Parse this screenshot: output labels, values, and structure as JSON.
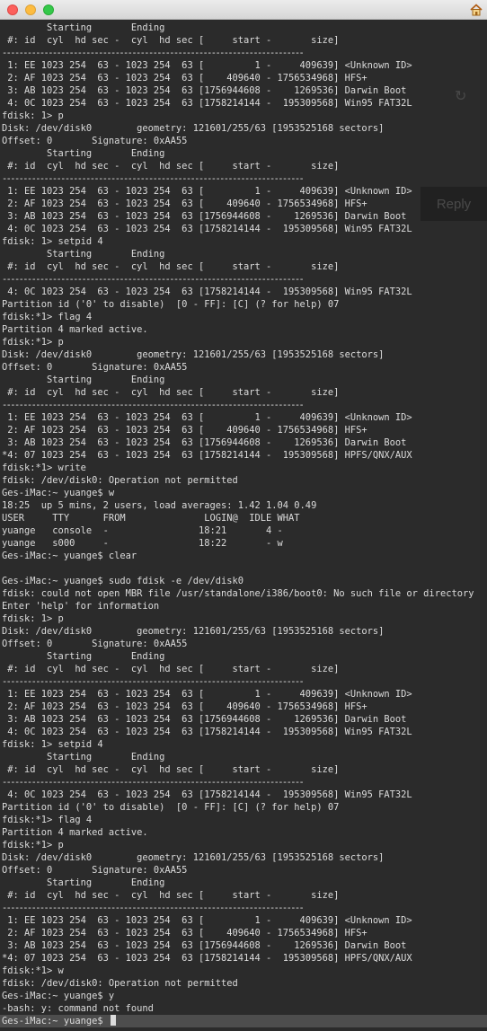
{
  "window": {
    "title": ""
  },
  "terminal": {
    "lines": [
      "        Starting       Ending",
      " #: id  cyl  hd sec -  cyl  hd sec [     start -       size]",
      "------------------------------------------------------------------------",
      " 1: EE 1023 254  63 - 1023 254  63 [         1 -     409639] <Unknown ID>",
      " 2: AF 1023 254  63 - 1023 254  63 [    409640 - 1756534968] HFS+",
      " 3: AB 1023 254  63 - 1023 254  63 [1756944608 -    1269536] Darwin Boot",
      " 4: 0C 1023 254  63 - 1023 254  63 [1758214144 -  195309568] Win95 FAT32L",
      "fdisk: 1> p",
      "Disk: /dev/disk0        geometry: 121601/255/63 [1953525168 sectors]",
      "Offset: 0       Signature: 0xAA55",
      "        Starting       Ending",
      " #: id  cyl  hd sec -  cyl  hd sec [     start -       size]",
      "------------------------------------------------------------------------",
      " 1: EE 1023 254  63 - 1023 254  63 [         1 -     409639] <Unknown ID>",
      " 2: AF 1023 254  63 - 1023 254  63 [    409640 - 1756534968] HFS+",
      " 3: AB 1023 254  63 - 1023 254  63 [1756944608 -    1269536] Darwin Boot",
      " 4: 0C 1023 254  63 - 1023 254  63 [1758214144 -  195309568] Win95 FAT32L",
      "fdisk: 1> setpid 4",
      "        Starting       Ending",
      " #: id  cyl  hd sec -  cyl  hd sec [     start -       size]",
      "------------------------------------------------------------------------",
      " 4: 0C 1023 254  63 - 1023 254  63 [1758214144 -  195309568] Win95 FAT32L",
      "Partition id ('0' to disable)  [0 - FF]: [C] (? for help) 07",
      "fdisk:*1> flag 4",
      "Partition 4 marked active.",
      "fdisk:*1> p",
      "Disk: /dev/disk0        geometry: 121601/255/63 [1953525168 sectors]",
      "Offset: 0       Signature: 0xAA55",
      "        Starting       Ending",
      " #: id  cyl  hd sec -  cyl  hd sec [     start -       size]",
      "------------------------------------------------------------------------",
      " 1: EE 1023 254  63 - 1023 254  63 [         1 -     409639] <Unknown ID>",
      " 2: AF 1023 254  63 - 1023 254  63 [    409640 - 1756534968] HFS+",
      " 3: AB 1023 254  63 - 1023 254  63 [1756944608 -    1269536] Darwin Boot",
      "*4: 07 1023 254  63 - 1023 254  63 [1758214144 -  195309568] HPFS/QNX/AUX",
      "fdisk:*1> write",
      "fdisk: /dev/disk0: Operation not permitted",
      "Ges-iMac:~ yuange$ w",
      "18:25  up 5 mins, 2 users, load averages: 1.42 1.04 0.49",
      "USER     TTY      FROM              LOGIN@  IDLE WHAT",
      "yuange   console  -                18:21       4 -",
      "yuange   s000     -                18:22       - w",
      "Ges-iMac:~ yuange$ clear",
      "",
      "Ges-iMac:~ yuange$ sudo fdisk -e /dev/disk0",
      "fdisk: could not open MBR file /usr/standalone/i386/boot0: No such file or directory",
      "Enter 'help' for information",
      "fdisk: 1> p",
      "Disk: /dev/disk0        geometry: 121601/255/63 [1953525168 sectors]",
      "Offset: 0       Signature: 0xAA55",
      "        Starting       Ending",
      " #: id  cyl  hd sec -  cyl  hd sec [     start -       size]",
      "------------------------------------------------------------------------",
      " 1: EE 1023 254  63 - 1023 254  63 [         1 -     409639] <Unknown ID>",
      " 2: AF 1023 254  63 - 1023 254  63 [    409640 - 1756534968] HFS+",
      " 3: AB 1023 254  63 - 1023 254  63 [1756944608 -    1269536] Darwin Boot",
      " 4: 0C 1023 254  63 - 1023 254  63 [1758214144 -  195309568] Win95 FAT32L",
      "fdisk: 1> setpid 4",
      "        Starting       Ending",
      " #: id  cyl  hd sec -  cyl  hd sec [     start -       size]",
      "------------------------------------------------------------------------",
      " 4: 0C 1023 254  63 - 1023 254  63 [1758214144 -  195309568] Win95 FAT32L",
      "Partition id ('0' to disable)  [0 - FF]: [C] (? for help) 07",
      "fdisk:*1> flag 4",
      "Partition 4 marked active.",
      "fdisk:*1> p",
      "Disk: /dev/disk0        geometry: 121601/255/63 [1953525168 sectors]",
      "Offset: 0       Signature: 0xAA55",
      "        Starting       Ending",
      " #: id  cyl  hd sec -  cyl  hd sec [     start -       size]",
      "------------------------------------------------------------------------",
      " 1: EE 1023 254  63 - 1023 254  63 [         1 -     409639] <Unknown ID>",
      " 2: AF 1023 254  63 - 1023 254  63 [    409640 - 1756534968] HFS+",
      " 3: AB 1023 254  63 - 1023 254  63 [1756944608 -    1269536] Darwin Boot",
      "*4: 07 1023 254  63 - 1023 254  63 [1758214144 -  195309568] HPFS/QNX/AUX",
      "fdisk:*1> w",
      "fdisk: /dev/disk0: Operation not permitted",
      "Ges-iMac:~ yuange$ y",
      "-bash: y: command not found",
      "Ges-iMac:~ yuange$ "
    ],
    "highlighted_line": 79
  },
  "background_ghost": {
    "reply_label": "Reply"
  },
  "colors": {
    "background": "#2b2b2b",
    "text": "#dcdcdc",
    "highlight": "#4d4d4d"
  },
  "icons": {
    "home": "home-icon",
    "refresh": "refresh-icon"
  }
}
